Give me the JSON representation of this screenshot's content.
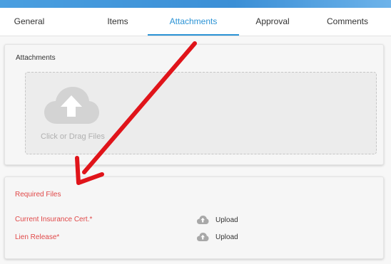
{
  "tabs": [
    {
      "label": "General"
    },
    {
      "label": "Items"
    },
    {
      "label": "Attachments"
    },
    {
      "label": "Approval"
    },
    {
      "label": "Comments"
    }
  ],
  "active_tab": "Attachments",
  "attachments": {
    "title": "Attachments",
    "drop_text": "Click or Drag Files"
  },
  "required_files": {
    "title": "Required Files",
    "items": [
      {
        "label": "Current Insurance Cert.*",
        "action": "Upload"
      },
      {
        "label": "Lien Release*",
        "action": "Upload"
      }
    ]
  },
  "colors": {
    "accent": "#2b93d5",
    "required": "#e04848",
    "annotation_arrow": "#e0141a"
  }
}
